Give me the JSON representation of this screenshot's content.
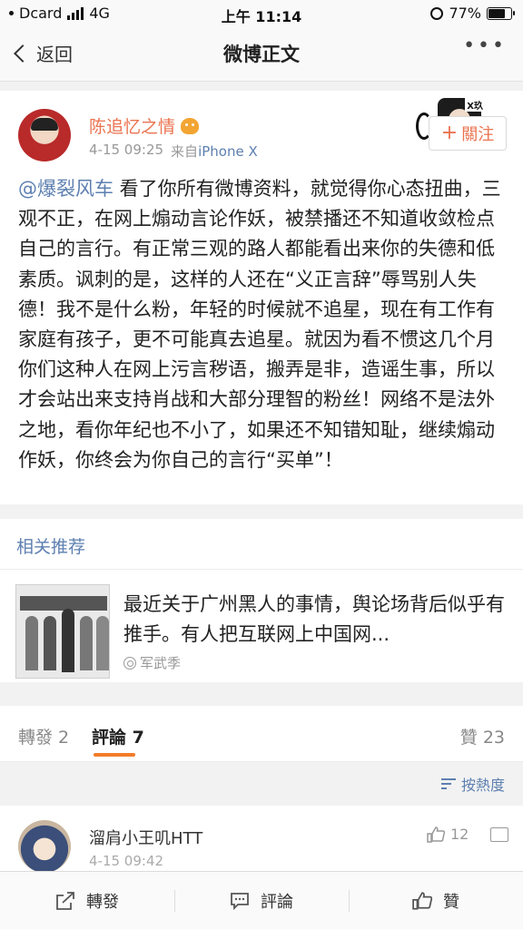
{
  "status_bar": {
    "carrier": "Dcard",
    "network": "4G",
    "time": "上午 11:14",
    "battery": "77%",
    "battery_level": 0.77
  },
  "nav": {
    "back_label": "返回",
    "title": "微博正文"
  },
  "post": {
    "author": "陈追忆之情",
    "time": "4-15 09:25",
    "source_prefix": "来自",
    "source": "iPhone X",
    "follow_label": "關注",
    "mention": "@爆裂风车",
    "body": " 看了你所有微博资料，就觉得你心态扭曲，三观不正，在网上煽动言论作妖，被禁播还不知道收敛检点自己的言行。有正常三观的路人都能看出来你的失德和低素质。讽刺的是，这样的人还在“义正言辞”辱骂别人失德！我不是什么粉，年轻的时候就不追星，现在有工作有家庭有孩子，更不可能真去追星。就因为看不惯这几个月你们这种人在网上污言秽语，搬弄是非，造谣生事，所以才会站出来支持肖战和大部分理智的粉丝！网络不是法外之地，看你年纪也不小了，如果还不知错知耻，继续煽动作妖，你终会为你自己的言行“买单”！"
  },
  "related": {
    "header": "相关推荐",
    "text": "最近关于广州黑人的事情，舆论场背后似乎有推手。有人把互联网上中国网...",
    "source": "军武季"
  },
  "tabs": {
    "repost": "轉發 2",
    "comment": "評論 7",
    "like": "贊 23"
  },
  "sort": {
    "label": "按熱度"
  },
  "comment": {
    "user": "溜肩小王叽HTT",
    "time": "4-15 09:42",
    "likes": "12"
  },
  "bottom_bar": {
    "repost": "轉發",
    "comment": "評論",
    "like": "贊"
  },
  "icons": {
    "back": "chevron-left-icon",
    "more": "more-icon",
    "follow": "plus-icon",
    "sort": "sort-icon",
    "like": "thumbs-up-icon",
    "reply": "comment-icon",
    "repost": "share-icon"
  },
  "colors": {
    "accent_orange": "#eb7350",
    "link_blue": "#5d7fb0",
    "tab_underline": "#f47c28"
  }
}
